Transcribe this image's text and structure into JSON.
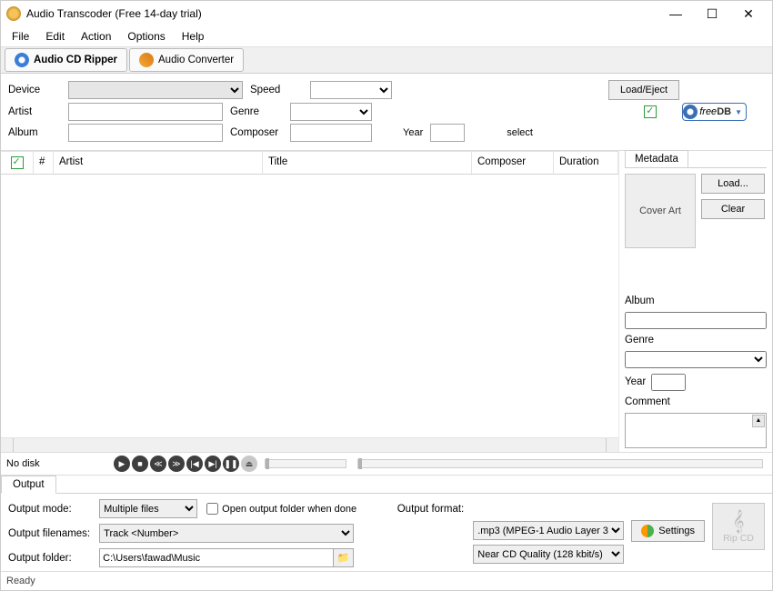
{
  "window": {
    "title": "Audio Transcoder (Free 14-day trial)"
  },
  "menu": {
    "file": "File",
    "edit": "Edit",
    "action": "Action",
    "options": "Options",
    "help": "Help"
  },
  "tabs": {
    "ripper": "Audio CD Ripper",
    "converter": "Audio Converter"
  },
  "info": {
    "device_label": "Device",
    "speed_label": "Speed",
    "load_eject": "Load/Eject",
    "artist_label": "Artist",
    "genre_label": "Genre",
    "album_label": "Album",
    "composer_label": "Composer",
    "year_label": "Year",
    "select_label": "select",
    "freedb_free": "free",
    "freedb_db": "DB"
  },
  "tracklist": {
    "cols": {
      "num": "#",
      "artist": "Artist",
      "title": "Title",
      "composer": "Composer",
      "duration": "Duration"
    }
  },
  "metadata": {
    "tab": "Metadata",
    "coverart": "Cover Art",
    "load": "Load...",
    "clear": "Clear",
    "album": "Album",
    "genre": "Genre",
    "year": "Year",
    "comment": "Comment"
  },
  "playback": {
    "nodisk": "No disk"
  },
  "output": {
    "tab": "Output",
    "mode_label": "Output mode:",
    "mode_value": "Multiple files",
    "open_after": "Open output folder when done",
    "filenames_label": "Output filenames:",
    "filenames_value": "Track <Number>",
    "folder_label": "Output folder:",
    "folder_value": "C:\\Users\\fawad\\Music",
    "format_label": "Output format:",
    "format_value": ".mp3 (MPEG-1 Audio Layer 3)",
    "quality_value": "Near CD Quality (128 kbit/s)",
    "settings": "Settings",
    "rip": "Rip CD"
  },
  "statusbar": {
    "ready": "Ready"
  }
}
